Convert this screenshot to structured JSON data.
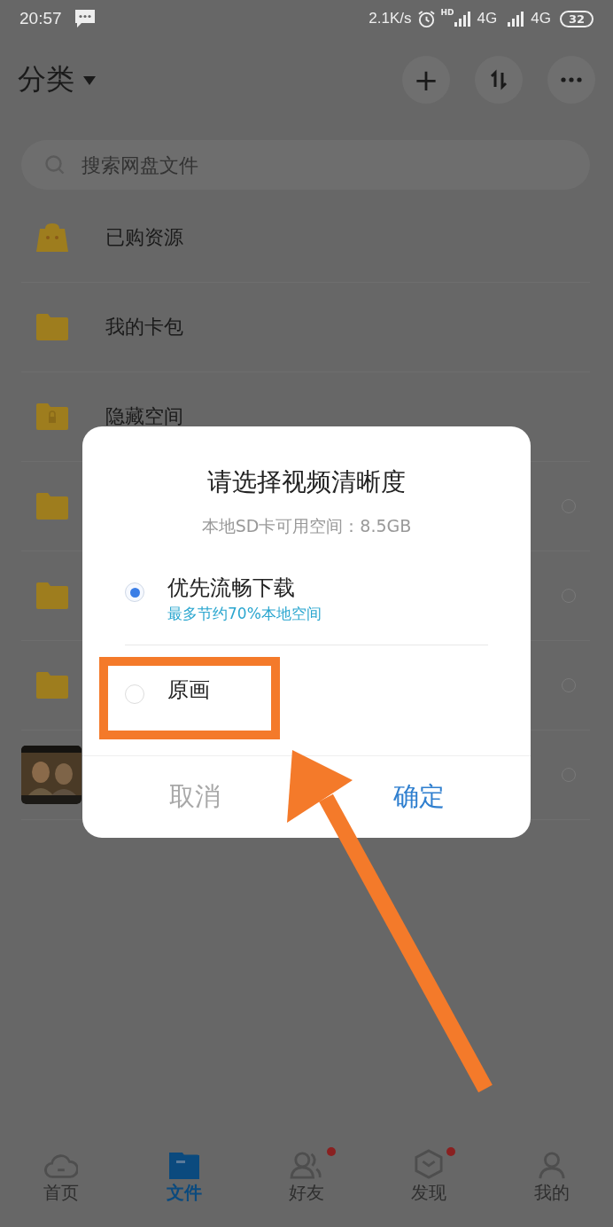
{
  "status_bar": {
    "time": "20:57",
    "speed": "2.1K/s",
    "hd": "HD",
    "network_1": "4G",
    "network_2": "4G",
    "battery": "32"
  },
  "header": {
    "title": "分类",
    "actions": [
      {
        "kind": "add",
        "label": "+"
      },
      {
        "kind": "sort"
      },
      {
        "kind": "more"
      }
    ]
  },
  "search": {
    "placeholder": "搜索网盘文件"
  },
  "files": [
    {
      "kind": "bag",
      "name": "已购资源",
      "selectable": false
    },
    {
      "kind": "folder",
      "name": "我的卡包",
      "selectable": false
    },
    {
      "kind": "lock",
      "name": "隐藏空间",
      "selectable": false
    },
    {
      "kind": "folder",
      "selectable": true
    },
    {
      "kind": "folder",
      "selectable": true
    },
    {
      "kind": "folder",
      "selectable": true
    },
    {
      "kind": "video",
      "selectable": true
    }
  ],
  "dialog": {
    "title": "请选择视频清晰度",
    "subtitle": "本地SD卡可用空间：8.5GB",
    "options": [
      {
        "label": "优先流畅下载",
        "hint": "最多节约70%本地空间",
        "selected": true
      },
      {
        "label": "原画",
        "selected": false
      }
    ],
    "buttons": [
      {
        "kind": "cancel",
        "label": "取消"
      },
      {
        "kind": "confirm",
        "label": "确定"
      }
    ]
  },
  "nav": [
    {
      "kind": "home",
      "label": "首页",
      "selected": false,
      "dot": false
    },
    {
      "kind": "files",
      "label": "文件",
      "selected": true,
      "dot": false
    },
    {
      "kind": "friends",
      "label": "好友",
      "selected": false,
      "dot": true
    },
    {
      "kind": "discover",
      "label": "发现",
      "selected": false,
      "dot": true
    },
    {
      "kind": "me",
      "label": "我的",
      "selected": false,
      "dot": false
    }
  ]
}
